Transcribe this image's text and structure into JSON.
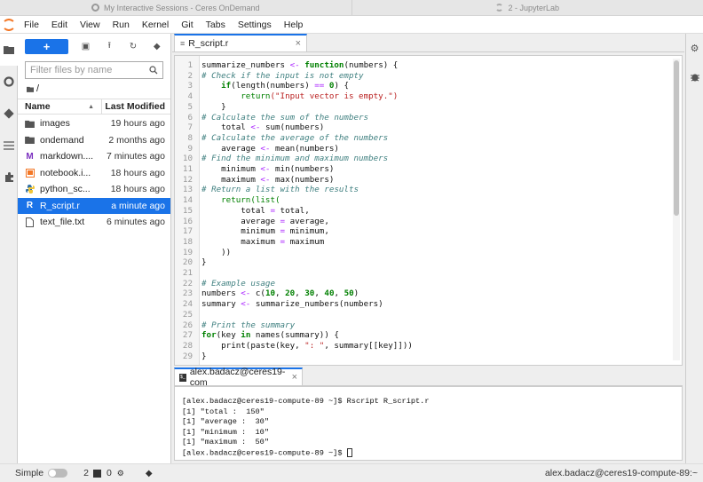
{
  "browser_tabs": [
    {
      "title": "My Interactive Sessions - Ceres OnDemand",
      "icon": "ondemand-icon"
    },
    {
      "title": "2 - JupyterLab",
      "icon": "jupyter-icon"
    }
  ],
  "menubar": {
    "items": [
      "File",
      "Edit",
      "View",
      "Run",
      "Kernel",
      "Git",
      "Tabs",
      "Settings",
      "Help"
    ]
  },
  "left_rail": [
    "folder-icon",
    "running-icon",
    "git-icon",
    "toc-icon",
    "extension-icon"
  ],
  "file_browser": {
    "new_button": "+",
    "toolbar_icons": [
      "new-folder-icon",
      "upload-icon",
      "refresh-icon",
      "git-clone-icon"
    ],
    "filter_placeholder": "Filter files by name",
    "breadcrumb": "/",
    "columns": {
      "name": "Name",
      "modified": "Last Modified"
    },
    "files": [
      {
        "name": "images",
        "modified": "19 hours ago",
        "icon": "folder-icon",
        "selected": false
      },
      {
        "name": "ondemand",
        "modified": "2 months ago",
        "icon": "folder-icon",
        "selected": false
      },
      {
        "name": "markdown....",
        "modified": "7 minutes ago",
        "icon": "markdown-icon",
        "selected": false
      },
      {
        "name": "notebook.i...",
        "modified": "18 hours ago",
        "icon": "notebook-icon",
        "selected": false
      },
      {
        "name": "python_sc...",
        "modified": "18 hours ago",
        "icon": "python-icon",
        "selected": false
      },
      {
        "name": "R_script.r",
        "modified": "a minute ago",
        "icon": "r-file-icon",
        "selected": true
      },
      {
        "name": "text_file.txt",
        "modified": "6 minutes ago",
        "icon": "text-file-icon",
        "selected": false
      }
    ]
  },
  "editor": {
    "tab_label": "R_script.r",
    "lines": [
      [
        [
          "t",
          "summarize_numbers "
        ],
        [
          "op",
          "<-"
        ],
        [
          "t",
          " "
        ],
        [
          "kw",
          "function"
        ],
        [
          "t",
          "(numbers) {"
        ]
      ],
      [
        [
          "cm",
          "# Check if the input is not empty"
        ]
      ],
      [
        [
          "t",
          "    "
        ],
        [
          "kw",
          "if"
        ],
        [
          "t",
          "(length(numbers) "
        ],
        [
          "op",
          "=="
        ],
        [
          "t",
          " "
        ],
        [
          "nm",
          "0"
        ],
        [
          "t",
          ") {"
        ]
      ],
      [
        [
          "t",
          "        "
        ],
        [
          "kw2",
          "return"
        ],
        [
          "st",
          "(\"Input vector is empty.\")"
        ]
      ],
      [
        [
          "t",
          "    }"
        ]
      ],
      [
        [
          "cm",
          "# Calculate the sum of the numbers"
        ]
      ],
      [
        [
          "t",
          "    total "
        ],
        [
          "op",
          "<-"
        ],
        [
          "t",
          " sum(numbers)"
        ]
      ],
      [
        [
          "cm",
          "# Calculate the average of the numbers"
        ]
      ],
      [
        [
          "t",
          "    average "
        ],
        [
          "op",
          "<-"
        ],
        [
          "t",
          " mean(numbers)"
        ]
      ],
      [
        [
          "cm",
          "# Find the minimum and maximum numbers"
        ]
      ],
      [
        [
          "t",
          "    minimum "
        ],
        [
          "op",
          "<-"
        ],
        [
          "t",
          " min(numbers)"
        ]
      ],
      [
        [
          "t",
          "    maximum "
        ],
        [
          "op",
          "<-"
        ],
        [
          "t",
          " max(numbers)"
        ]
      ],
      [
        [
          "cm",
          "# Return a list with the results"
        ]
      ],
      [
        [
          "t",
          "    "
        ],
        [
          "kw2",
          "return(list("
        ]
      ],
      [
        [
          "t",
          "        total "
        ],
        [
          "op",
          "="
        ],
        [
          "t",
          " total,"
        ]
      ],
      [
        [
          "t",
          "        average "
        ],
        [
          "op",
          "="
        ],
        [
          "t",
          " average,"
        ]
      ],
      [
        [
          "t",
          "        minimum "
        ],
        [
          "op",
          "="
        ],
        [
          "t",
          " minimum,"
        ]
      ],
      [
        [
          "t",
          "        maximum "
        ],
        [
          "op",
          "="
        ],
        [
          "t",
          " maximum"
        ]
      ],
      [
        [
          "t",
          "    ))"
        ]
      ],
      [
        [
          "t",
          "}"
        ]
      ],
      [
        [
          "t",
          ""
        ]
      ],
      [
        [
          "cm",
          "# Example usage"
        ]
      ],
      [
        [
          "t",
          "numbers "
        ],
        [
          "op",
          "<-"
        ],
        [
          "t",
          " c("
        ],
        [
          "nm",
          "10"
        ],
        [
          "t",
          ", "
        ],
        [
          "nm",
          "20"
        ],
        [
          "t",
          ", "
        ],
        [
          "nm",
          "30"
        ],
        [
          "t",
          ", "
        ],
        [
          "nm",
          "40"
        ],
        [
          "t",
          ", "
        ],
        [
          "nm",
          "50"
        ],
        [
          "t",
          ")"
        ]
      ],
      [
        [
          "t",
          "summary "
        ],
        [
          "op",
          "<-"
        ],
        [
          "t",
          " summarize_numbers(numbers)"
        ]
      ],
      [
        [
          "t",
          ""
        ]
      ],
      [
        [
          "cm",
          "# Print the summary"
        ]
      ],
      [
        [
          "kw",
          "for"
        ],
        [
          "t",
          "(key "
        ],
        [
          "kw",
          "in"
        ],
        [
          "t",
          " names(summary)) {"
        ]
      ],
      [
        [
          "t",
          "    print(paste(key, "
        ],
        [
          "st",
          "\": \""
        ],
        [
          "t",
          ", summary[[key]]))"
        ]
      ],
      [
        [
          "t",
          "}"
        ]
      ]
    ]
  },
  "terminal": {
    "tab_label": "alex.badacz@ceres19-com",
    "lines": [
      "[alex.badacz@ceres19-compute-89 ~]$ Rscript R_script.r",
      "[1] \"total :  150\"",
      "[1] \"average :  30\"",
      "[1] \"minimum :  10\"",
      "[1] \"maximum :  50\"",
      "[alex.badacz@ceres19-compute-89 ~]$ "
    ]
  },
  "right_rail": [
    "property-inspector-icon",
    "debugger-icon"
  ],
  "statusbar": {
    "mode_label": "Simple",
    "terminals_count": "2",
    "kernels_count": "0",
    "right_text": "alex.badacz@ceres19-compute-89:~"
  }
}
